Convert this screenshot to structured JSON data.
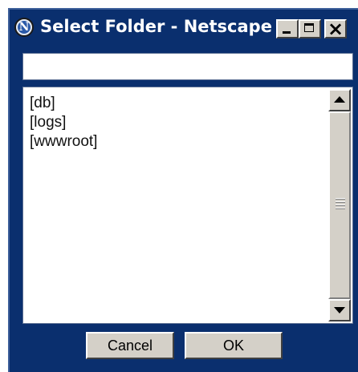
{
  "window": {
    "title": "Select Folder - Netscape",
    "app_icon_glyph": "N",
    "caption_buttons": [
      "minimize-icon",
      "maximize-icon",
      "close-icon"
    ]
  },
  "path_input": {
    "value": "",
    "placeholder": ""
  },
  "folder_list": {
    "items": [
      "[db]",
      "[logs]",
      "[wwwroot]"
    ]
  },
  "buttons": {
    "cancel_label": "Cancel",
    "ok_label": "OK"
  },
  "colors": {
    "titlebar": "#0a2f6e",
    "button_face": "#d4d0c8"
  }
}
